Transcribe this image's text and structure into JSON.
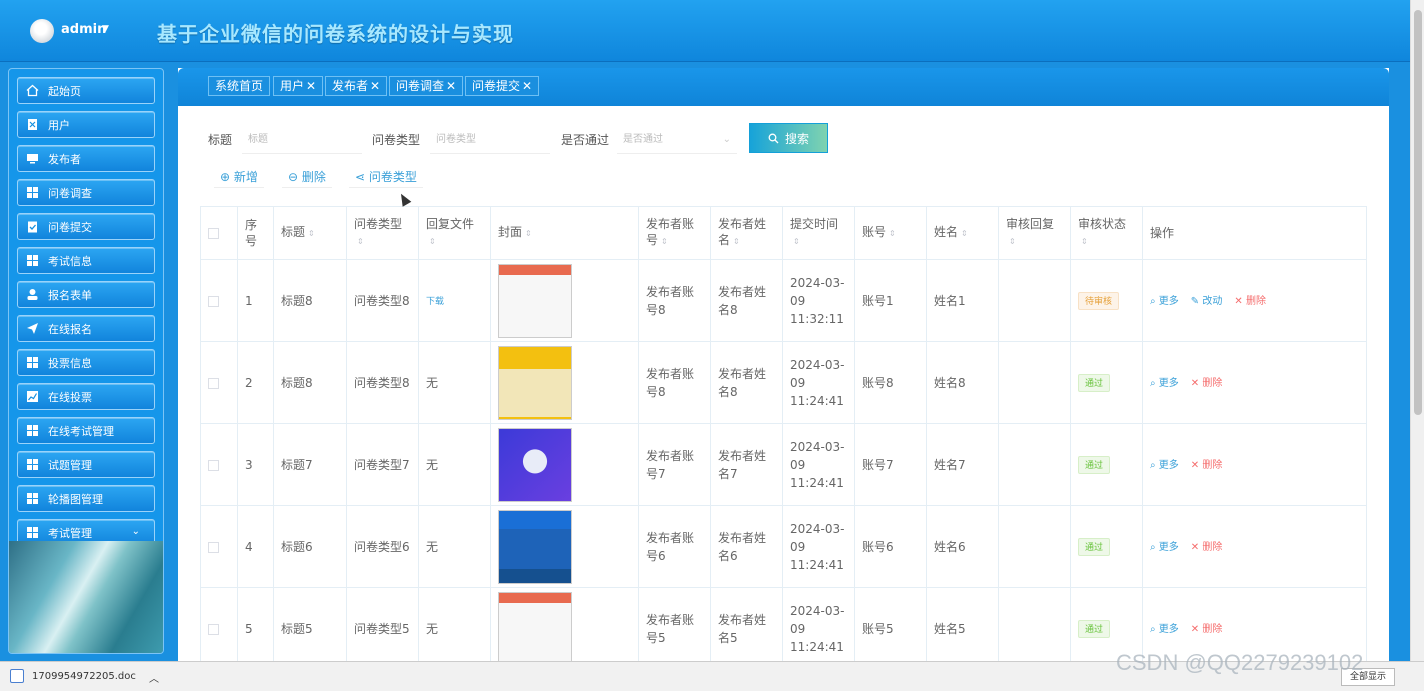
{
  "header": {
    "username": "admin",
    "system_title": "基于企业微信的问卷系统的设计与实现"
  },
  "sidebar": {
    "items": [
      {
        "label": "起始页",
        "icon": "home-icon"
      },
      {
        "label": "用户",
        "icon": "user-doc-icon"
      },
      {
        "label": "发布者",
        "icon": "monitor-icon"
      },
      {
        "label": "问卷调查",
        "icon": "grid-icon"
      },
      {
        "label": "问卷提交",
        "icon": "clipboard-check-icon"
      },
      {
        "label": "考试信息",
        "icon": "grid-icon"
      },
      {
        "label": "报名表单",
        "icon": "person-icon"
      },
      {
        "label": "在线报名",
        "icon": "paper-plane-icon"
      },
      {
        "label": "投票信息",
        "icon": "grid-icon"
      },
      {
        "label": "在线投票",
        "icon": "chart-line-icon"
      },
      {
        "label": "在线考试管理",
        "icon": "grid-icon"
      },
      {
        "label": "试题管理",
        "icon": "grid-icon"
      },
      {
        "label": "轮播图管理",
        "icon": "grid-icon"
      },
      {
        "label": "考试管理",
        "icon": "grid-icon"
      }
    ]
  },
  "tabs": [
    {
      "label": "系统首页",
      "closable": false
    },
    {
      "label": "用户",
      "closable": true
    },
    {
      "label": "发布者",
      "closable": true
    },
    {
      "label": "问卷调查",
      "closable": true
    },
    {
      "label": "问卷提交",
      "closable": true
    }
  ],
  "filters": {
    "title_label": "标题",
    "title_placeholder": "标题",
    "type_label": "问卷类型",
    "type_placeholder": "问卷类型",
    "passed_label": "是否通过",
    "passed_placeholder": "是否通过",
    "search_label": "搜索"
  },
  "actions": {
    "add_label": "新增",
    "delete_label": "删除",
    "type_label": "问卷类型"
  },
  "table": {
    "headers": [
      "序号",
      "标题",
      "问卷类型",
      "回复文件",
      "封面",
      "发布者账号",
      "发布者姓名",
      "提交时间",
      "账号",
      "姓名",
      "审核回复",
      "审核状态",
      "操作"
    ],
    "rows": [
      {
        "index": "1",
        "title": "标题8",
        "type": "问卷类型8",
        "file": "下载",
        "pub_account": "发布者账号8",
        "pub_name": "发布者姓名8",
        "time": "2024-03-09 11:32:11",
        "account": "账号1",
        "name": "姓名1",
        "reply": "",
        "status": "待审核",
        "ops": [
          "更多",
          "改动",
          "删除"
        ]
      },
      {
        "index": "2",
        "title": "标题8",
        "type": "问卷类型8",
        "file": "无",
        "pub_account": "发布者账号8",
        "pub_name": "发布者姓名8",
        "time": "2024-03-09 11:24:41",
        "account": "账号8",
        "name": "姓名8",
        "reply": "",
        "status": "通过",
        "ops": [
          "更多",
          "删除"
        ]
      },
      {
        "index": "3",
        "title": "标题7",
        "type": "问卷类型7",
        "file": "无",
        "pub_account": "发布者账号7",
        "pub_name": "发布者姓名7",
        "time": "2024-03-09 11:24:41",
        "account": "账号7",
        "name": "姓名7",
        "reply": "",
        "status": "通过",
        "ops": [
          "更多",
          "删除"
        ]
      },
      {
        "index": "4",
        "title": "标题6",
        "type": "问卷类型6",
        "file": "无",
        "pub_account": "发布者账号6",
        "pub_name": "发布者姓名6",
        "time": "2024-03-09 11:24:41",
        "account": "账号6",
        "name": "姓名6",
        "reply": "",
        "status": "通过",
        "ops": [
          "更多",
          "删除"
        ]
      },
      {
        "index": "5",
        "title": "标题5",
        "type": "问卷类型5",
        "file": "无",
        "pub_account": "发布者账号5",
        "pub_name": "发布者姓名5",
        "time": "2024-03-09 11:24:41",
        "account": "账号5",
        "name": "姓名5",
        "reply": "",
        "status": "通过",
        "ops": [
          "更多",
          "删除"
        ]
      }
    ]
  },
  "download_bar": {
    "file_name": "1709954972205.doc",
    "show_all_label": "全部显示"
  },
  "watermark": "CSDN @QQ2279239102",
  "colors": {
    "primary_blue": "#1a90e0",
    "accent_link": "#3aa0d8",
    "danger": "#f56c6c",
    "pass": "#67c23a",
    "pending": "#e6a23c"
  }
}
